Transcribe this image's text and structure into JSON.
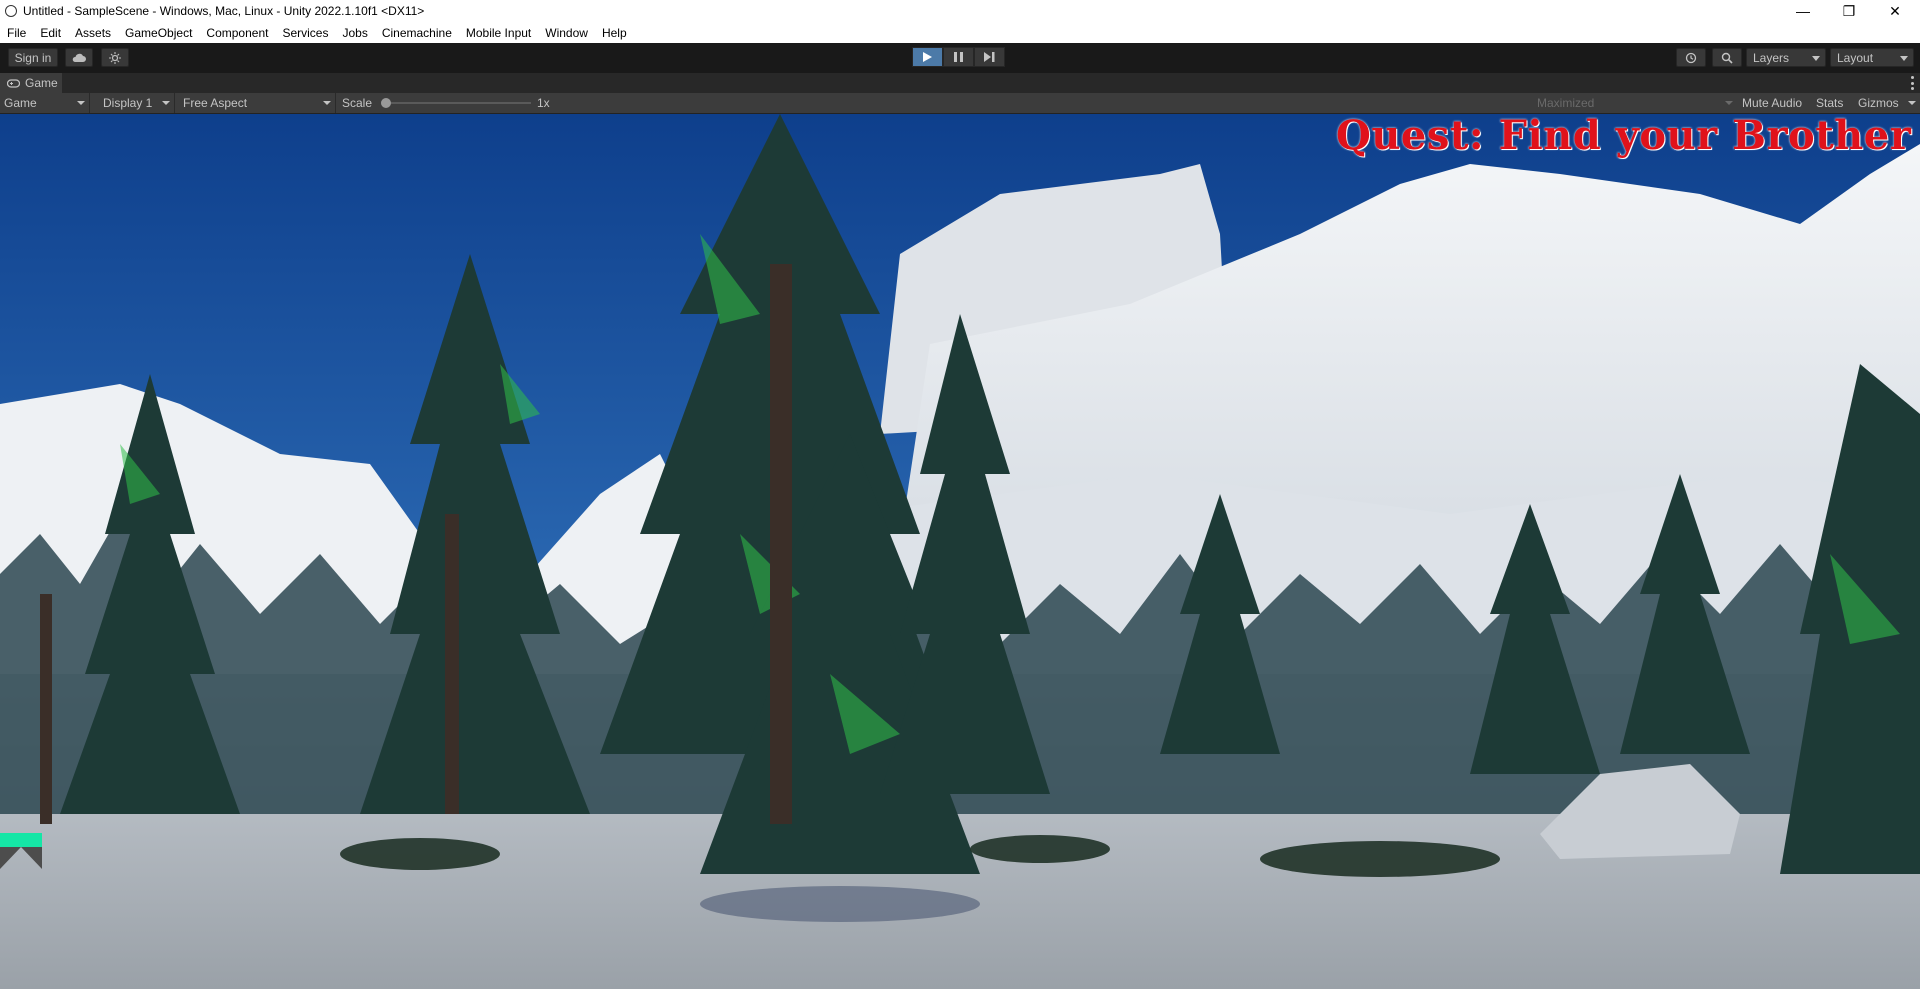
{
  "window": {
    "title": "Untitled - SampleScene - Windows, Mac, Linux - Unity 2022.1.10f1 <DX11>",
    "controls": [
      "minimize",
      "restore",
      "close"
    ]
  },
  "menu": [
    "File",
    "Edit",
    "Assets",
    "GameObject",
    "Component",
    "Services",
    "Jobs",
    "Cinemachine",
    "Mobile Input",
    "Window",
    "Help"
  ],
  "toolbar": {
    "sign_in": "Sign in",
    "layers": "Layers",
    "layout": "Layout"
  },
  "tab": {
    "label": "Game"
  },
  "gamebar": {
    "mode": "Game",
    "display": "Display 1",
    "aspect": "Free Aspect",
    "scale_label": "Scale",
    "scale_value": "1x",
    "maximized": "Maximized",
    "mute_audio": "Mute Audio",
    "stats": "Stats",
    "gizmos": "Gizmos"
  },
  "game": {
    "quest_text": "Quest: Find your Brother",
    "health_color": "#15e6a6",
    "quest_color": "#e0121b"
  }
}
